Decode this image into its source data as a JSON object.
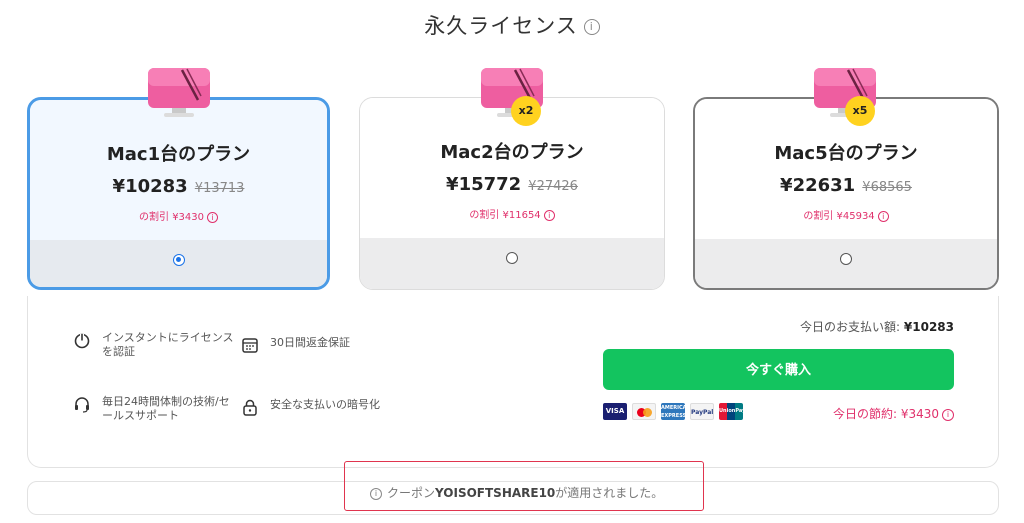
{
  "header": {
    "title": "永久ライセンス",
    "info_icon": "info-icon"
  },
  "plans": [
    {
      "name": "Mac1台のプラン",
      "price": "¥10283",
      "old_price": "¥13713",
      "discount_label": "の割引",
      "discount_value": "¥3430",
      "badge": "",
      "selected": true
    },
    {
      "name": "Mac2台のプラン",
      "price": "¥15772",
      "old_price": "¥27426",
      "discount_label": "の割引",
      "discount_value": "¥11654",
      "badge": "x2",
      "selected": false
    },
    {
      "name": "Mac5台のプラン",
      "price": "¥22631",
      "old_price": "¥68565",
      "discount_label": "の割引",
      "discount_value": "¥45934",
      "badge": "x5",
      "selected": false
    }
  ],
  "features": [
    {
      "icon": "power-icon",
      "text_line1": "インスタントにライセンス",
      "text_line2": "を認証"
    },
    {
      "icon": "calendar-icon",
      "text_line1": "30日間返金保証",
      "text_line2": ""
    },
    {
      "icon": "headset-icon",
      "text_line1": "毎日24時間体制の技術/セ",
      "text_line2": "ールスサポート"
    },
    {
      "icon": "lock-icon",
      "text_line1": "安全な支払いの暗号化",
      "text_line2": ""
    }
  ],
  "checkout": {
    "total_label": "今日のお支払い額:",
    "total_value": "¥10283",
    "buy_label": "今すぐ購入",
    "savings_label": "今日の節約:",
    "savings_value": "¥3430",
    "payment_methods": [
      {
        "name": "visa-icon",
        "label": "VISA"
      },
      {
        "name": "mastercard-icon",
        "label": ""
      },
      {
        "name": "amex-icon",
        "label": "AMERICAN EXPRESS"
      },
      {
        "name": "paypal-icon",
        "label": "PayPal"
      },
      {
        "name": "unionpay-icon",
        "label": "UnionPay"
      }
    ]
  },
  "coupon": {
    "prefix": "クーポン",
    "code": "YOISOFTSHARE10",
    "suffix": "が適用されました。"
  },
  "colors": {
    "accent_blue": "#4b9be6",
    "buy_green": "#13c45f",
    "discount_pink": "#e0306b",
    "badge_yellow": "#ffd21f",
    "highlight_red": "#e0344e"
  }
}
